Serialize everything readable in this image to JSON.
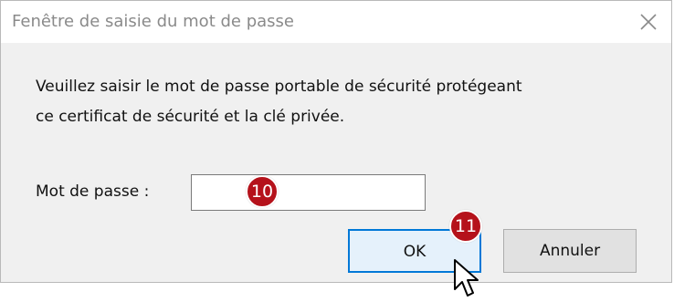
{
  "window": {
    "title": "Fenêtre de saisie du mot de passe",
    "close_icon": "close-icon"
  },
  "message": {
    "line1": "Veuillez saisir le mot de passe portable de sécurité protégeant",
    "line2": "ce certificat de sécurité et la clé privée."
  },
  "password": {
    "label": "Mot de passe :",
    "value": ""
  },
  "buttons": {
    "ok": "OK",
    "cancel": "Annuler"
  },
  "annotations": {
    "step_input": "10",
    "step_ok": "11"
  },
  "colors": {
    "accent": "#0078d7",
    "badge": "#b5121b"
  },
  "pointer_icon": "arrow-cursor-icon"
}
